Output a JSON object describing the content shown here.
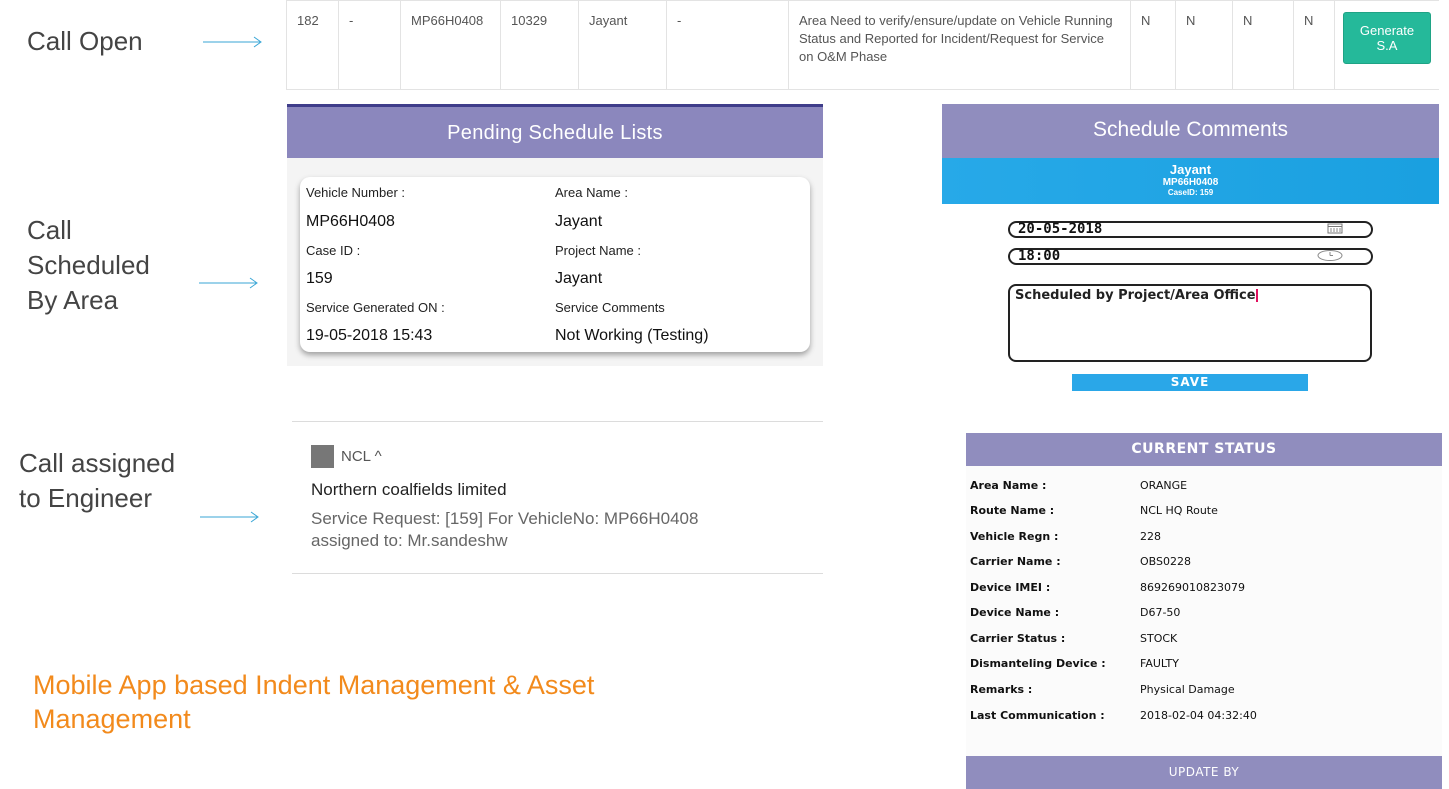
{
  "labels": {
    "call_open": "Call Open",
    "call_scheduled": [
      "Call",
      "Scheduled",
      "By Area"
    ],
    "call_assigned": [
      "Call assigned",
      "to Engineer"
    ]
  },
  "table_row": {
    "cells": [
      "182",
      "-",
      "MP66H0408",
      "10329",
      "Jayant",
      "-",
      "Area Need to verify/ensure/update on Vehicle Running Status and Reported for Incident/Request for Service on O&M Phase",
      "N",
      "N",
      "N",
      "N"
    ],
    "button": "Generate S.A"
  },
  "pending": {
    "title": "Pending Schedule Lists",
    "fields": [
      {
        "label": "Vehicle Number :",
        "value": "MP66H0408"
      },
      {
        "label": "Area Name :",
        "value": "Jayant"
      },
      {
        "label": "Case ID :",
        "value": "159"
      },
      {
        "label": "Project Name :",
        "value": "Jayant"
      },
      {
        "label": "Service Generated ON :",
        "value": "19-05-2018 15:43"
      },
      {
        "label": "Service Comments",
        "value": "Not Working (Testing)"
      }
    ]
  },
  "comments": {
    "title": "Schedule Comments",
    "name": "Jayant",
    "vehicle": "MP66H0408",
    "case": "CaseID: 159",
    "date": "20-05-2018",
    "time": "18:00",
    "text": "Scheduled by Project/Area Office",
    "save": "SAVE"
  },
  "notification": {
    "app": "NCL ^",
    "title": "Northern coalfields limited",
    "body": "Service Request: [159] For VehicleNo: MP66H0408 assigned to: Mr.sandeshw"
  },
  "status": {
    "title": "CURRENT STATUS",
    "rows": [
      {
        "k": "Area Name :",
        "v": "ORANGE"
      },
      {
        "k": "Route Name :",
        "v": "NCL HQ Route"
      },
      {
        "k": "Vehicle Regn :",
        "v": "228"
      },
      {
        "k": "Carrier Name :",
        "v": "OBS0228"
      },
      {
        "k": "Device IMEI :",
        "v": "869269010823079"
      },
      {
        "k": "Device Name :",
        "v": "D67-50"
      },
      {
        "k": "Carrier Status :",
        "v": "STOCK"
      },
      {
        "k": "Dismanteling Device :",
        "v": "FAULTY"
      },
      {
        "k": "Remarks :",
        "v": "Physical Damage"
      },
      {
        "k": "Last Communication :",
        "v": "2018-02-04 04:32:40"
      }
    ],
    "footer": "UPDATE BY"
  },
  "footer_title": "Mobile App based Indent Management & Asset Management",
  "colors": {
    "accent": "#908dbe",
    "button_green": "#25b99a",
    "blue": "#27a9e8",
    "orange": "#f28a1c"
  },
  "icons": [
    "arrow-right-icon",
    "calendar-icon",
    "clock-icon",
    "app-icon"
  ]
}
